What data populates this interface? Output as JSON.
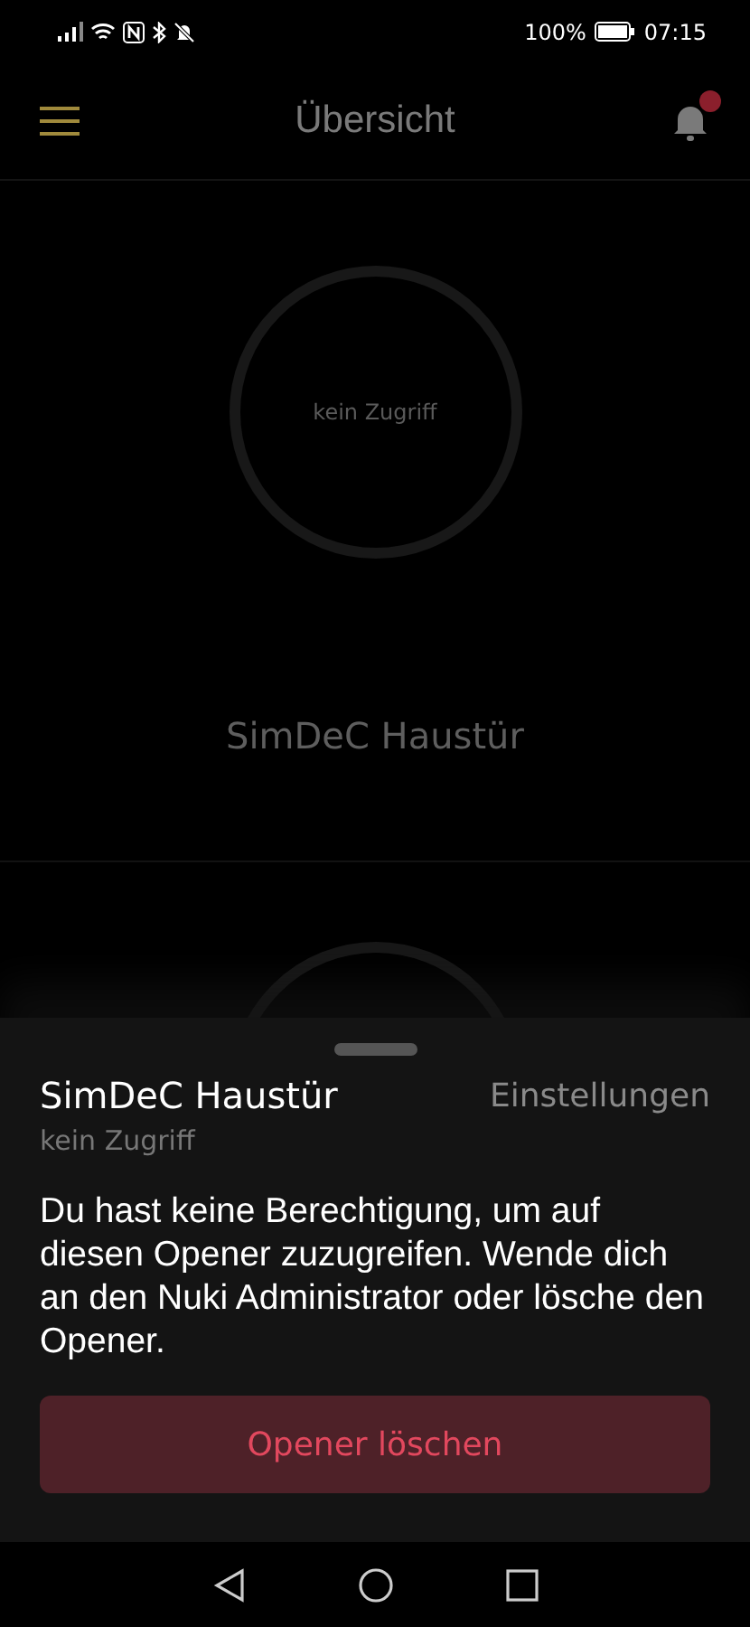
{
  "status_bar": {
    "battery": "100%",
    "time": "07:15"
  },
  "app_bar": {
    "title": "Übersicht",
    "notification_badge": true
  },
  "devices": [
    {
      "name": "SimDeC Haustür",
      "state": "kein Zugriff"
    },
    {
      "kind": "partial"
    }
  ],
  "sheet": {
    "title": "SimDeC Haustür",
    "subtitle": "kein Zugriff",
    "settings_link": "Einstellungen",
    "message": "Du hast keine Berechtigung, um auf diesen Opener zuzugreifen. Wende dich an den Nuki Administrator oder lösche den Opener.",
    "delete_button": "Opener löschen"
  }
}
